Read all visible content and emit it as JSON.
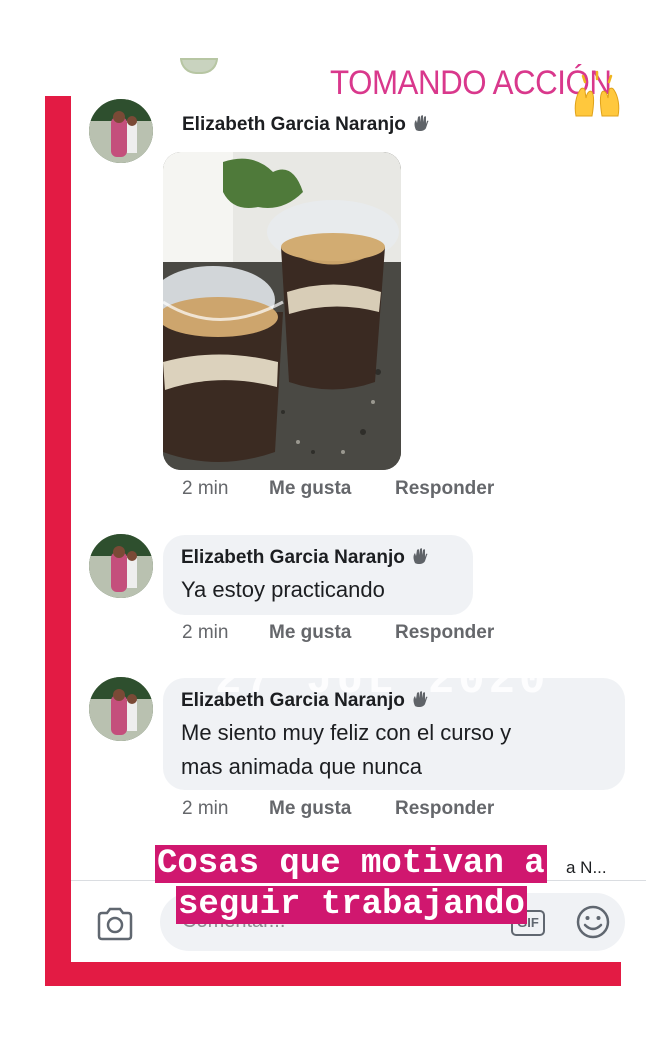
{
  "sticker": {
    "title": "TOMANDO ACCIÓN",
    "icon": "raised-hands-emoji"
  },
  "comments": [
    {
      "author": "Elizabeth Garcia Naranjo",
      "badge_icon": "waving-hand-icon",
      "photo": "photo-of-desserts-in-cups",
      "time": "2 min",
      "like": "Me gusta",
      "reply": "Responder"
    },
    {
      "author": "Elizabeth Garcia Naranjo",
      "badge_icon": "waving-hand-icon",
      "text": "Ya estoy practicando",
      "time": "2 min",
      "like": "Me gusta",
      "reply": "Responder"
    },
    {
      "author": "Elizabeth Garcia Naranjo",
      "badge_icon": "waving-hand-icon",
      "text_line1": "Me siento muy feliz con el curso y",
      "text_line2": "mas animada que nunca",
      "time": "2 min",
      "like": "Me gusta",
      "reply": "Responder"
    }
  ],
  "watermark": "27 JUL 2020",
  "truncated_reply": "a N...",
  "composer": {
    "placeholder": "Comentar...",
    "gif": "GIF"
  },
  "caption": {
    "line1": "Cosas que motivan a",
    "line2": "seguir trabajando"
  },
  "colors": {
    "frame": "#e31b44",
    "title": "#d9388c",
    "caption_bg": "#d0176f",
    "bubble": "#f0f2f5"
  }
}
